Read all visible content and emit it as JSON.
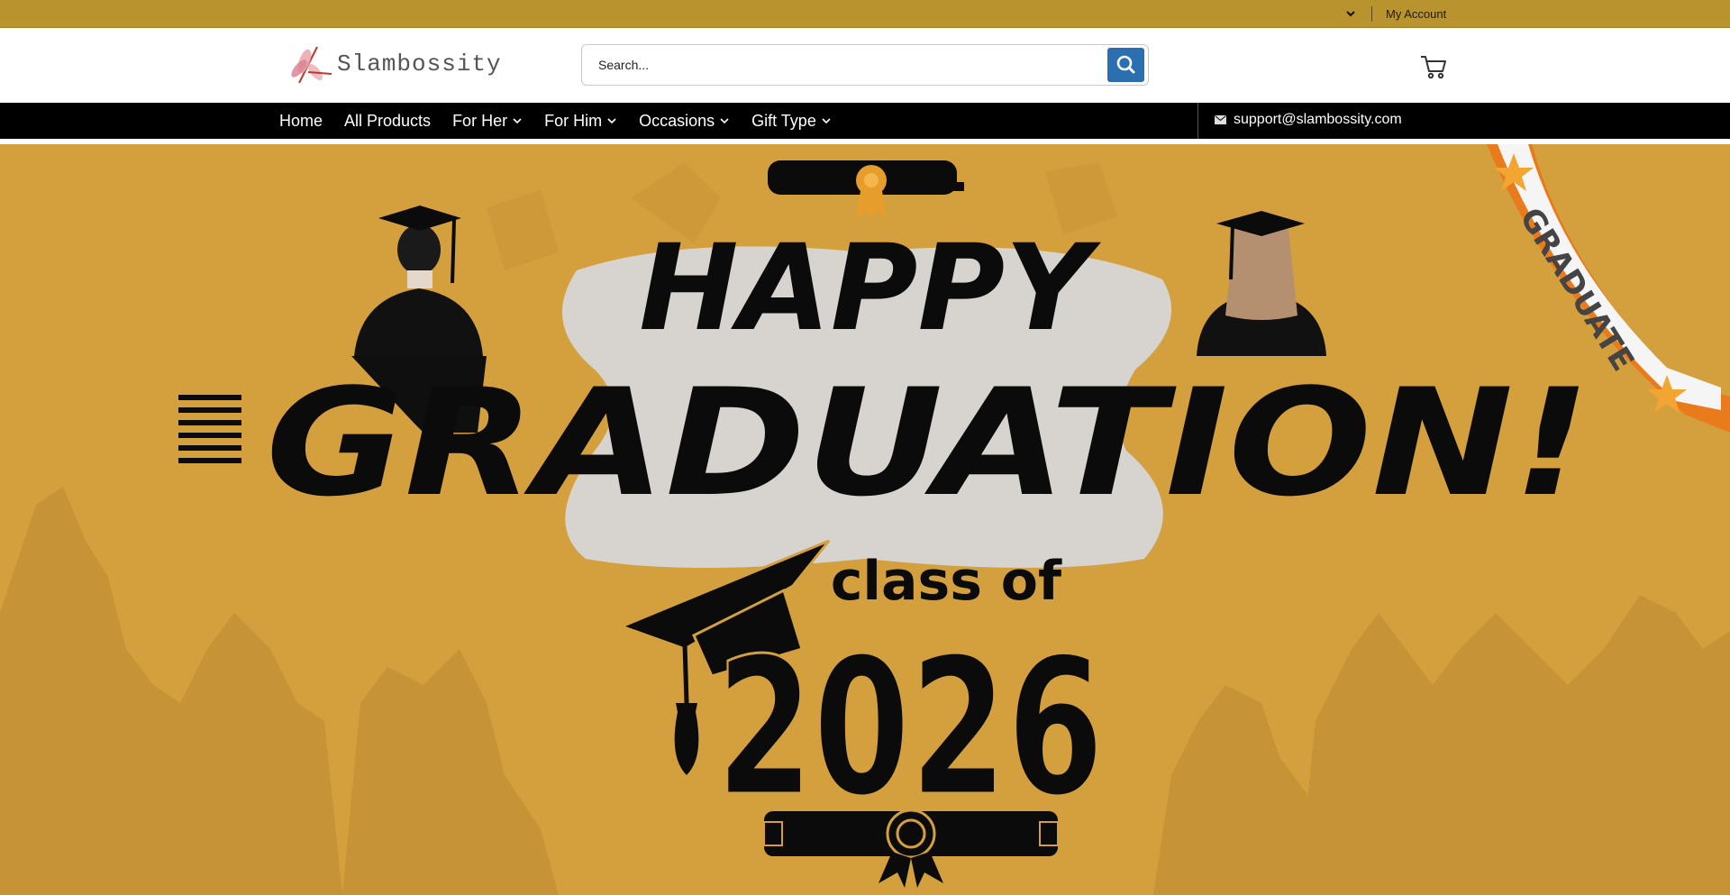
{
  "topbar": {
    "account_label": "My Account",
    "dropdown_icon": "chevron-down-icon"
  },
  "header": {
    "logo_text": "Slambossity",
    "logo_icon": "dragonfly-icon",
    "search": {
      "placeholder": "Search...",
      "value": "",
      "button_icon": "search-icon"
    },
    "cart_icon": "shopping-cart-icon"
  },
  "nav": {
    "items": [
      {
        "label": "Home",
        "has_dropdown": false
      },
      {
        "label": "All Products",
        "has_dropdown": false
      },
      {
        "label": "For Her",
        "has_dropdown": true
      },
      {
        "label": "For Him",
        "has_dropdown": true
      },
      {
        "label": "Occasions",
        "has_dropdown": true
      },
      {
        "label": "Gift Type",
        "has_dropdown": true
      }
    ],
    "email": "support@slambossity.com",
    "email_icon": "envelope-icon"
  },
  "hero": {
    "line1": "HAPPY",
    "line2": "GRADUATION!",
    "line3": "class of",
    "year": "2026",
    "ribbon": "GRADUATE"
  },
  "colors": {
    "topbar": "#b8932e",
    "nav": "#000000",
    "search_button": "#2a6fb0",
    "hero_background": "#d4a03e",
    "hero_text": "#0b0b0b",
    "ribbon_border": "#e97b1c",
    "star": "#f2a531"
  }
}
